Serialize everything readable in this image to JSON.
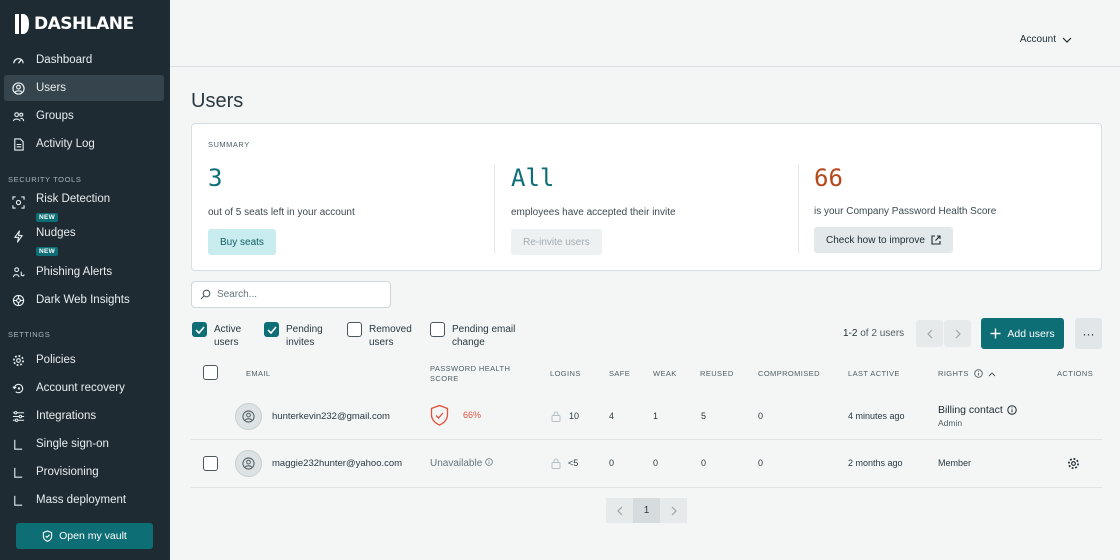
{
  "brand": {
    "name": "DASHLANE"
  },
  "sidebar": {
    "items": [
      {
        "label": "Dashboard",
        "icon": "dashboard-icon"
      },
      {
        "label": "Users",
        "icon": "user-icon"
      },
      {
        "label": "Groups",
        "icon": "groups-icon"
      },
      {
        "label": "Activity Log",
        "icon": "document-icon"
      }
    ],
    "security_title": "SECURITY TOOLS",
    "security_items": [
      {
        "label": "Risk Detection",
        "badge": "NEW",
        "icon": "risk-detection-icon"
      },
      {
        "label": "Nudges",
        "badge": "NEW",
        "icon": "lightning-icon"
      },
      {
        "label": "Phishing Alerts",
        "icon": "phishing-icon"
      },
      {
        "label": "Dark Web Insights",
        "icon": "dark-web-icon"
      }
    ],
    "settings_title": "SETTINGS",
    "settings_items": [
      {
        "label": "Policies",
        "icon": "gear-icon"
      },
      {
        "label": "Account recovery",
        "icon": "recovery-icon"
      },
      {
        "label": "Integrations",
        "icon": "sliders-icon"
      },
      {
        "label": "Single sign-on",
        "icon": "sub-item-icon"
      },
      {
        "label": "Provisioning",
        "icon": "sub-item-icon"
      },
      {
        "label": "Mass deployment",
        "icon": "sub-item-icon"
      }
    ],
    "vault_button": "Open my vault"
  },
  "header": {
    "account": "Account"
  },
  "page": {
    "title": "Users"
  },
  "summary": {
    "label": "SUMMARY",
    "seats": {
      "value": "3",
      "desc": "out of 5 seats left in your account",
      "button": "Buy seats"
    },
    "invites": {
      "value": "All",
      "desc": "employees have accepted their invite",
      "button": "Re-invite users"
    },
    "health": {
      "value": "66",
      "desc": "is your Company Password Health Score",
      "button": "Check how to improve"
    }
  },
  "search": {
    "placeholder": "Search..."
  },
  "filters": [
    {
      "line1": "Active",
      "line2": "users",
      "checked": true
    },
    {
      "line1": "Pending",
      "line2": "invites",
      "checked": true
    },
    {
      "line1": "Removed",
      "line2": "users",
      "checked": false
    },
    {
      "line1": "Pending email",
      "line2": "change",
      "checked": false
    }
  ],
  "pagination": {
    "range": "1-2",
    "of_text": "of 2 users",
    "current_page": "1"
  },
  "actions": {
    "add_users": "Add users",
    "more": "···"
  },
  "table": {
    "headers": {
      "email": "EMAIL",
      "health_line1": "PASSWORD HEALTH",
      "health_line2": "SCORE",
      "logins": "LOGINS",
      "safe": "SAFE",
      "weak": "WEAK",
      "reused": "REUSED",
      "compromised": "COMPROMISED",
      "last_active": "LAST ACTIVE",
      "rights": "RIGHTS",
      "actions": "ACTIONS"
    },
    "rows": [
      {
        "email": "hunterkevin232@gmail.com",
        "health": "66%",
        "logins": "10",
        "safe": "4",
        "weak": "1",
        "reused": "5",
        "compromised": "0",
        "last_active": "4 minutes ago",
        "rights": "Billing contact",
        "rights_sub": "Admin"
      },
      {
        "email": "maggie232hunter@yahoo.com",
        "health": "Unavailable",
        "logins": "<5",
        "safe": "0",
        "weak": "0",
        "reused": "0",
        "compromised": "0",
        "last_active": "2 months ago",
        "rights": "Member"
      }
    ]
  },
  "colors": {
    "accent": "#0e6e76",
    "sidebar": "#1e2b33",
    "health_orange": "#b44a1c",
    "warning_red": "#e0503c"
  }
}
